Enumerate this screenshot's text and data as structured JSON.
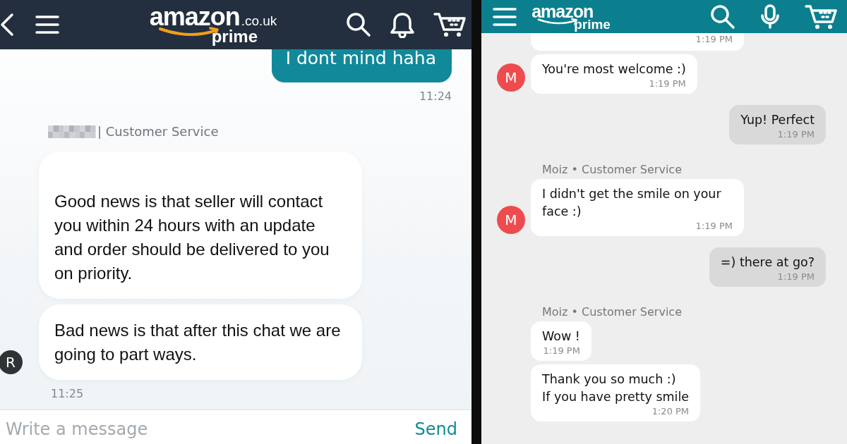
{
  "panels": [
    {
      "kind": "uk",
      "header": {
        "logo": "amazon",
        "domain": ".co.uk",
        "sub": "prime"
      },
      "messages": [
        {
          "kind": "outgoing",
          "text": "I dont mind haha"
        },
        {
          "kind": "sent-time",
          "text": "11:24"
        },
        {
          "kind": "sender",
          "name_redacted": true,
          "text": "| Customer Service"
        },
        {
          "kind": "incoming",
          "text": "Good news is that seller will contact you within 24 hours with an update and order should be delivered to you on priority.",
          "lead_gap": true
        },
        {
          "kind": "incoming",
          "text": "Bad news is that after this chat we are going to part ways.",
          "avatar": {
            "letter": "R",
            "color": "#2e3436"
          }
        },
        {
          "kind": "received-time",
          "text": "11:25"
        }
      ],
      "composer": {
        "placeholder": "Write a message",
        "send": "Send"
      }
    },
    {
      "kind": "app",
      "header": {
        "logo": "amazon",
        "sub": "prime"
      },
      "messages": [
        {
          "kind": "incoming",
          "time": "1:19 PM"
        },
        {
          "kind": "incoming",
          "text": "You're most welcome :)",
          "time": "1:19 PM",
          "avatar": {
            "letter": "M",
            "color": "#ee4b4f"
          }
        },
        {
          "kind": "outgoing",
          "text": "Yup! Perfect",
          "time": "1:19 PM"
        },
        {
          "kind": "sender",
          "text": "Moiz • Customer Service"
        },
        {
          "kind": "incoming",
          "text": "I didn't get the smile on your face :)",
          "time": "1:19 PM",
          "avatar": {
            "letter": "M",
            "color": "#ee4b4f"
          }
        },
        {
          "kind": "outgoing",
          "text": "=) there at go?",
          "time": "1:19 PM"
        },
        {
          "kind": "sender",
          "text": "Moiz • Customer Service"
        },
        {
          "kind": "incoming",
          "text": "Wow !",
          "time": "1:19 PM"
        },
        {
          "kind": "incoming",
          "text": "Thank you so much :)\nIf you have pretty smile",
          "time": "1:20 PM"
        }
      ]
    }
  ]
}
